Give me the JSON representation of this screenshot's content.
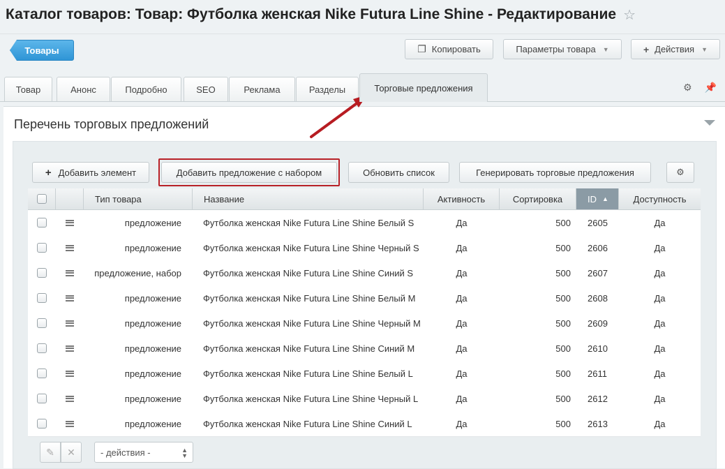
{
  "header": {
    "title": "Каталог товаров: Товар: Футболка женская Nike Futura Line Shine - Редактирование"
  },
  "toolbar": {
    "back_label": "Товары",
    "copy_label": "Копировать",
    "params_label": "Параметры товара",
    "actions_label": "Действия"
  },
  "tabs": [
    {
      "label": "Товар"
    },
    {
      "label": "Анонс"
    },
    {
      "label": "Подробно"
    },
    {
      "label": "SEO"
    },
    {
      "label": "Реклама"
    },
    {
      "label": "Разделы"
    },
    {
      "label": "Торговые предложения"
    }
  ],
  "section": {
    "title": "Перечень торговых предложений"
  },
  "grid_toolbar": {
    "add_element": "Добавить элемент",
    "add_offer_set": "Добавить предложение с набором",
    "refresh": "Обновить список",
    "generate": "Генерировать торговые предложения"
  },
  "columns": {
    "type": "Тип товара",
    "name": "Название",
    "active": "Активность",
    "sort": "Сортировка",
    "id": "ID",
    "avail": "Доступность"
  },
  "rows": [
    {
      "type": "предложение",
      "name": "Футболка женская Nike Futura Line Shine Белый S",
      "active": "Да",
      "sort": "500",
      "id": "2605",
      "avail": "Да"
    },
    {
      "type": "предложение",
      "name": "Футболка женская Nike Futura Line Shine Черный S",
      "active": "Да",
      "sort": "500",
      "id": "2606",
      "avail": "Да"
    },
    {
      "type": "предложение, набор",
      "name": "Футболка женская Nike Futura Line Shine Синий S",
      "active": "Да",
      "sort": "500",
      "id": "2607",
      "avail": "Да"
    },
    {
      "type": "предложение",
      "name": "Футболка женская Nike Futura Line Shine Белый M",
      "active": "Да",
      "sort": "500",
      "id": "2608",
      "avail": "Да"
    },
    {
      "type": "предложение",
      "name": "Футболка женская Nike Futura Line Shine Черный M",
      "active": "Да",
      "sort": "500",
      "id": "2609",
      "avail": "Да"
    },
    {
      "type": "предложение",
      "name": "Футболка женская Nike Futura Line Shine Синий M",
      "active": "Да",
      "sort": "500",
      "id": "2610",
      "avail": "Да"
    },
    {
      "type": "предложение",
      "name": "Футболка женская Nike Futura Line Shine Белый L",
      "active": "Да",
      "sort": "500",
      "id": "2611",
      "avail": "Да"
    },
    {
      "type": "предложение",
      "name": "Футболка женская Nike Futura Line Shine Черный L",
      "active": "Да",
      "sort": "500",
      "id": "2612",
      "avail": "Да"
    },
    {
      "type": "предложение",
      "name": "Футболка женская Nike Futura Line Shine Синий L",
      "active": "Да",
      "sort": "500",
      "id": "2613",
      "avail": "Да"
    }
  ],
  "footer": {
    "actions_select": "- действия -"
  },
  "colors": {
    "accent": "#2f95d6",
    "highlight": "#b82127",
    "arrow": "#b71c22",
    "sorted_header": "#8b9ba5"
  }
}
